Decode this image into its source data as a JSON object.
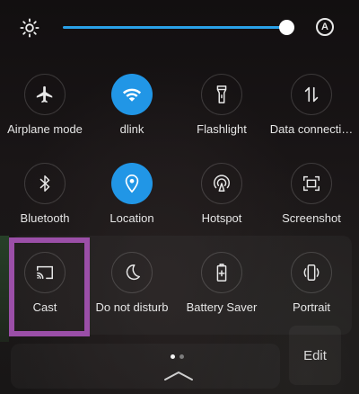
{
  "colors": {
    "accent": "#2196e6",
    "highlight_box": "#9b4fa8",
    "label_text": "#e6e6e6"
  },
  "brightness": {
    "level": 0.98,
    "auto_label": "A",
    "auto_icon": "auto-brightness-icon",
    "icon": "sun-icon"
  },
  "tiles": [
    {
      "label": "Airplane mode",
      "icon": "airplane-icon",
      "active": false
    },
    {
      "label": "dlink",
      "icon": "wifi-icon",
      "active": true
    },
    {
      "label": "Flashlight",
      "icon": "flashlight-icon",
      "active": false
    },
    {
      "label": "Data connecti…",
      "icon": "data-arrows-icon",
      "active": false
    },
    {
      "label": "Bluetooth",
      "icon": "bluetooth-icon",
      "active": false
    },
    {
      "label": "Location",
      "icon": "location-pin-icon",
      "active": true
    },
    {
      "label": "Hotspot",
      "icon": "hotspot-icon",
      "active": false
    },
    {
      "label": "Screenshot",
      "icon": "screenshot-icon",
      "active": false
    },
    {
      "label": "Cast",
      "icon": "cast-icon",
      "active": false
    },
    {
      "label": "Do not disturb",
      "icon": "moon-icon",
      "active": false
    },
    {
      "label": "Battery Saver",
      "icon": "battery-plus-icon",
      "active": false
    },
    {
      "label": "Portrait",
      "icon": "rotation-lock-icon",
      "active": false
    }
  ],
  "pager": {
    "page": 1,
    "total": 2
  },
  "edit_label": "Edit",
  "expand_icon": "chevron-up-icon"
}
